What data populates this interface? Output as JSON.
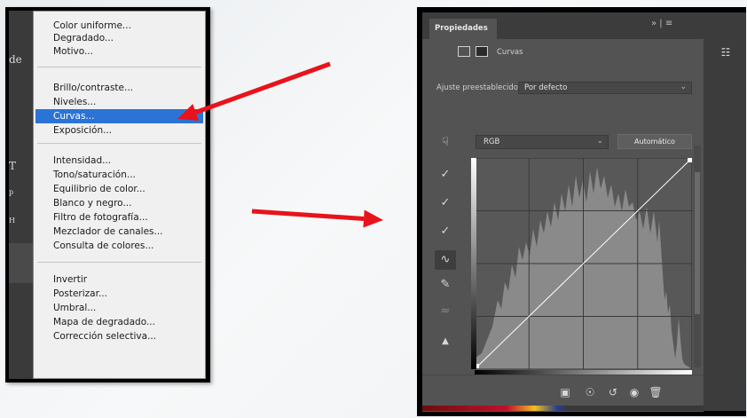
{
  "menu": {
    "left_sliver": [
      "de",
      "T",
      "p",
      "H"
    ],
    "items": [
      {
        "label": "Color uniforme...",
        "selected": false
      },
      {
        "label": "Degradado...",
        "selected": false
      },
      {
        "label": "Motivo...",
        "selected": false
      },
      {
        "label": "Brillo/contraste...",
        "selected": false
      },
      {
        "label": "Niveles...",
        "selected": false
      },
      {
        "label": "Curvas...",
        "selected": true
      },
      {
        "label": "Exposición...",
        "selected": false
      },
      {
        "label": "Intensidad...",
        "selected": false
      },
      {
        "label": "Tono/saturación...",
        "selected": false
      },
      {
        "label": "Equilibrio de color...",
        "selected": false
      },
      {
        "label": "Blanco y negro...",
        "selected": false
      },
      {
        "label": "Filtro de fotografía...",
        "selected": false
      },
      {
        "label": "Mezclador de canales...",
        "selected": false
      },
      {
        "label": "Consulta de colores...",
        "selected": false
      },
      {
        "label": "Invertir",
        "selected": false
      },
      {
        "label": "Posterizar...",
        "selected": false
      },
      {
        "label": "Umbral...",
        "selected": false
      },
      {
        "label": "Mapa de degradado...",
        "selected": false
      },
      {
        "label": "Corrección selectiva...",
        "selected": false
      }
    ],
    "selection_color": "#2b74d6"
  },
  "arrow_color": "#e8131b",
  "properties": {
    "tab_title": "Propiedades",
    "tab_controls": "»  |  ≡",
    "panel_label": "Curvas",
    "preset_label": "Ajuste preestablecido:",
    "preset_value": "Por defecto",
    "channel_value": "RGB",
    "auto_button": "Automático",
    "tools": [
      "on-image-adjust-icon",
      "black-eyedropper-icon",
      "gray-eyedropper-icon",
      "white-eyedropper-icon",
      "curve-point-icon",
      "pencil-icon",
      "smooth-icon",
      "clipping-warning-icon"
    ],
    "bottom_icons": [
      "clip-to-layer-icon",
      "view-previous-icon",
      "reset-icon",
      "visibility-icon",
      "trash-icon"
    ]
  }
}
